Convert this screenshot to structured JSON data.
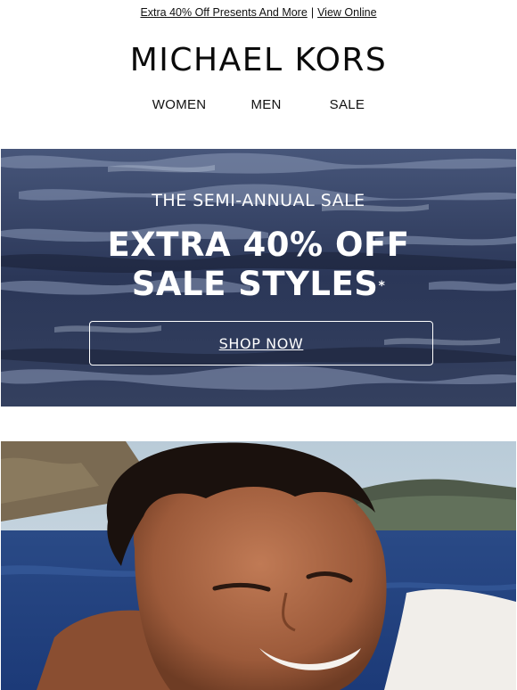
{
  "preheader": {
    "promo_link": "Extra 40% Off Presents And More",
    "separator": "|",
    "view_online": "View Online"
  },
  "brand": {
    "logo_text": "MICHAEL KORS"
  },
  "nav": {
    "items": [
      {
        "label": "WOMEN"
      },
      {
        "label": "MEN"
      },
      {
        "label": "SALE"
      }
    ]
  },
  "hero": {
    "kicker": "THE SEMI-ANNUAL SALE",
    "headline_line1": "EXTRA 40% OFF",
    "headline_line2": "SALE STYLES",
    "asterisk": "*",
    "cta_label": "SHOP NOW"
  },
  "colors": {
    "hero_water": "#2a3654",
    "text": "#111111",
    "white": "#ffffff"
  }
}
